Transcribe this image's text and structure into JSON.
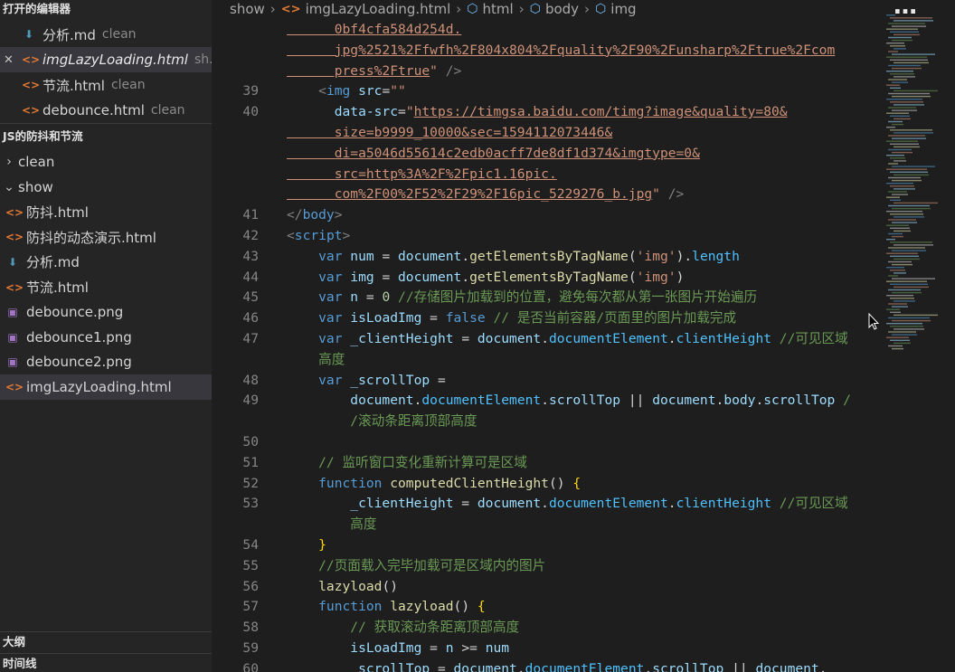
{
  "sidebar": {
    "open_editors_title": "打开的编辑器",
    "open_editors": [
      {
        "name": "分析.md",
        "status": "clean",
        "type": "md",
        "italic": false,
        "active": false
      },
      {
        "name": "imgLazyLoading.html",
        "status": "sh...",
        "type": "html",
        "italic": true,
        "active": true
      },
      {
        "name": "节流.html",
        "status": "clean",
        "type": "html",
        "italic": false,
        "active": false
      },
      {
        "name": "debounce.html",
        "status": "clean",
        "type": "html",
        "italic": false,
        "active": false
      }
    ],
    "project_title": "JS的防抖和节流",
    "folders": [
      {
        "name": "clean",
        "expanded": false
      },
      {
        "name": "show",
        "expanded": true
      }
    ],
    "files": [
      {
        "name": "防抖.html",
        "type": "html"
      },
      {
        "name": "防抖的动态演示.html",
        "type": "html"
      },
      {
        "name": "分析.md",
        "type": "md"
      },
      {
        "name": "节流.html",
        "type": "html"
      },
      {
        "name": "debounce.png",
        "type": "img"
      },
      {
        "name": "debounce1.png",
        "type": "img"
      },
      {
        "name": "debounce2.png",
        "type": "img"
      },
      {
        "name": "imgLazyLoading.html",
        "type": "html",
        "active": true
      }
    ],
    "outline_title": "大纲",
    "timeline_title": "时间线"
  },
  "breadcrumb": {
    "folder": "show",
    "file": "imgLazyLoading.html",
    "path": [
      "html",
      "body",
      "img"
    ]
  },
  "watermark": "…",
  "code_lines": [
    {
      "n": "",
      "tokens": [
        [
          "t-str",
          "      0bf4cfa584d254d."
        ]
      ]
    },
    {
      "n": "",
      "tokens": [
        [
          "t-str",
          "      jpg%2521%2Ffwfh%2F804x804%2Fquality%2F90%2Funsharp%2Ftrue%2Fcom"
        ]
      ]
    },
    {
      "n": "",
      "tokens": [
        [
          "t-str",
          "      press%2Ftrue"
        ],
        [
          "t-strp",
          "\""
        ],
        [
          "t-tag",
          " />"
        ]
      ]
    },
    {
      "n": "39",
      "tokens": [
        [
          "t-tag",
          "    <"
        ],
        [
          "t-name",
          "img"
        ],
        [
          "t-attr",
          " src"
        ],
        [
          "t-plain",
          "="
        ],
        [
          "t-strp",
          "\"\""
        ]
      ]
    },
    {
      "n": "40",
      "tokens": [
        [
          "t-attr",
          "      data-src"
        ],
        [
          "t-plain",
          "="
        ],
        [
          "t-strp",
          "\""
        ],
        [
          "t-str",
          "https://timgsa.baidu.com/timg?image&quality=80&"
        ]
      ]
    },
    {
      "n": "",
      "tokens": [
        [
          "t-str",
          "      size=b9999_10000&sec=1594112073446&"
        ]
      ]
    },
    {
      "n": "",
      "tokens": [
        [
          "t-str",
          "      di=a5046d55614c2edb0acff7de8df1d374&imgtype=0&"
        ]
      ]
    },
    {
      "n": "",
      "tokens": [
        [
          "t-str",
          "      src=http%3A%2F%2Fpic1.16pic."
        ]
      ]
    },
    {
      "n": "",
      "tokens": [
        [
          "t-str",
          "      com%2F00%2F52%2F29%2F16pic_5229276_b.jpg"
        ],
        [
          "t-strp",
          "\""
        ],
        [
          "t-tag",
          " />"
        ]
      ]
    },
    {
      "n": "41",
      "tokens": [
        [
          "t-tag",
          "</"
        ],
        [
          "t-name",
          "body"
        ],
        [
          "t-tag",
          ">"
        ]
      ]
    },
    {
      "n": "42",
      "tokens": [
        [
          "t-tag",
          "<"
        ],
        [
          "t-name",
          "script"
        ],
        [
          "t-tag",
          ">"
        ]
      ]
    },
    {
      "n": "43",
      "tokens": [
        [
          "t-kw",
          "    var "
        ],
        [
          "t-var",
          "num"
        ],
        [
          "t-plain",
          " = "
        ],
        [
          "t-var",
          "document"
        ],
        [
          "t-plain",
          "."
        ],
        [
          "t-fn",
          "getElementsByTagName"
        ],
        [
          "t-plain",
          "("
        ],
        [
          "t-strp",
          "'img'"
        ],
        [
          "t-plain",
          ")."
        ],
        [
          "t-prop",
          "length"
        ]
      ]
    },
    {
      "n": "44",
      "tokens": [
        [
          "t-kw",
          "    var "
        ],
        [
          "t-var",
          "img"
        ],
        [
          "t-plain",
          " = "
        ],
        [
          "t-var",
          "document"
        ],
        [
          "t-plain",
          "."
        ],
        [
          "t-fn",
          "getElementsByTagName"
        ],
        [
          "t-plain",
          "("
        ],
        [
          "t-strp",
          "'img'"
        ],
        [
          "t-plain",
          ")"
        ]
      ]
    },
    {
      "n": "45",
      "tokens": [
        [
          "t-kw",
          "    var "
        ],
        [
          "t-var",
          "n"
        ],
        [
          "t-plain",
          " = "
        ],
        [
          "t-num",
          "0"
        ],
        [
          "t-com",
          " //存储图片加载到的位置，避免每次都从第一张图片开始遍历"
        ]
      ]
    },
    {
      "n": "46",
      "tokens": [
        [
          "t-kw",
          "    var "
        ],
        [
          "t-var",
          "isLoadImg"
        ],
        [
          "t-plain",
          " = "
        ],
        [
          "t-kw",
          "false"
        ],
        [
          "t-com",
          " // 是否当前容器/页面里的图片加载完成"
        ]
      ]
    },
    {
      "n": "47",
      "tokens": [
        [
          "t-kw",
          "    var "
        ],
        [
          "t-var",
          "_clientHeight"
        ],
        [
          "t-plain",
          " = "
        ],
        [
          "t-var",
          "document"
        ],
        [
          "t-plain",
          "."
        ],
        [
          "t-prop",
          "documentElement"
        ],
        [
          "t-plain",
          "."
        ],
        [
          "t-prop",
          "clientHeight"
        ],
        [
          "t-com",
          " //可见区域"
        ]
      ]
    },
    {
      "n": "",
      "tokens": [
        [
          "t-com",
          "    高度"
        ]
      ]
    },
    {
      "n": "48",
      "tokens": [
        [
          "t-kw",
          "    var "
        ],
        [
          "t-var",
          "_scrollTop"
        ],
        [
          "t-plain",
          " ="
        ]
      ]
    },
    {
      "n": "49",
      "tokens": [
        [
          "t-var",
          "        document"
        ],
        [
          "t-plain",
          "."
        ],
        [
          "t-prop",
          "documentElement"
        ],
        [
          "t-plain",
          "."
        ],
        [
          "t-var",
          "scrollTop"
        ],
        [
          "t-plain",
          " || "
        ],
        [
          "t-var",
          "document"
        ],
        [
          "t-plain",
          "."
        ],
        [
          "t-var",
          "body"
        ],
        [
          "t-plain",
          "."
        ],
        [
          "t-var",
          "scrollTop"
        ],
        [
          "t-com",
          " /"
        ]
      ]
    },
    {
      "n": "",
      "tokens": [
        [
          "t-com",
          "        /滚动条距离顶部高度"
        ]
      ]
    },
    {
      "n": "50",
      "tokens": []
    },
    {
      "n": "51",
      "tokens": [
        [
          "t-com",
          "    // 监听窗口变化重新计算可是区域"
        ]
      ]
    },
    {
      "n": "52",
      "tokens": [
        [
          "t-kw",
          "    function "
        ],
        [
          "t-fn",
          "computedClientHeight"
        ],
        [
          "t-plain",
          "() "
        ],
        [
          "t-brace",
          "{"
        ]
      ]
    },
    {
      "n": "53",
      "tokens": [
        [
          "t-var",
          "        _clientHeight"
        ],
        [
          "t-plain",
          " = "
        ],
        [
          "t-var",
          "document"
        ],
        [
          "t-plain",
          "."
        ],
        [
          "t-prop",
          "documentElement"
        ],
        [
          "t-plain",
          "."
        ],
        [
          "t-prop",
          "clientHeight"
        ],
        [
          "t-com",
          " //可见区域"
        ]
      ]
    },
    {
      "n": "",
      "tokens": [
        [
          "t-com",
          "        高度"
        ]
      ]
    },
    {
      "n": "54",
      "tokens": [
        [
          "t-brace",
          "    }"
        ]
      ]
    },
    {
      "n": "55",
      "tokens": [
        [
          "t-com",
          "    //页面载入完毕加载可是区域内的图片"
        ]
      ]
    },
    {
      "n": "56",
      "tokens": [
        [
          "t-fn",
          "    lazyload"
        ],
        [
          "t-plain",
          "()"
        ]
      ]
    },
    {
      "n": "57",
      "tokens": [
        [
          "t-kw",
          "    function "
        ],
        [
          "t-fn",
          "lazyload"
        ],
        [
          "t-plain",
          "() "
        ],
        [
          "t-brace",
          "{"
        ]
      ]
    },
    {
      "n": "58",
      "tokens": [
        [
          "t-com",
          "        // 获取滚动条距离顶部高度"
        ]
      ]
    },
    {
      "n": "59",
      "tokens": [
        [
          "t-var",
          "        isLoadImg"
        ],
        [
          "t-plain",
          " = "
        ],
        [
          "t-var",
          "n"
        ],
        [
          "t-plain",
          " >= "
        ],
        [
          "t-var",
          "num"
        ]
      ]
    },
    {
      "n": "60",
      "tokens": [
        [
          "t-var",
          "        _scrollTop"
        ],
        [
          "t-plain",
          " = "
        ],
        [
          "t-var",
          "document"
        ],
        [
          "t-plain",
          "."
        ],
        [
          "t-prop",
          "documentElement"
        ],
        [
          "t-plain",
          "."
        ],
        [
          "t-var",
          "scrollTop"
        ],
        [
          "t-plain",
          " || "
        ],
        [
          "t-var",
          "document"
        ],
        [
          "t-plain",
          "."
        ]
      ]
    }
  ],
  "colors": {
    "sidebar_bg": "#252526",
    "editor_bg": "#1e1e1e",
    "active_row": "#37373d",
    "html_icon": "#e37933",
    "md_icon": "#519aba",
    "img_icon": "#a074c4"
  },
  "icons": {
    "html": "code-brackets-icon",
    "md": "arrow-down-icon",
    "img": "image-icon",
    "breadcrumb_symbol": "cube-icon",
    "close": "close-icon",
    "chevron_right": "chevron-right-icon",
    "chevron_down": "chevron-down-icon"
  }
}
